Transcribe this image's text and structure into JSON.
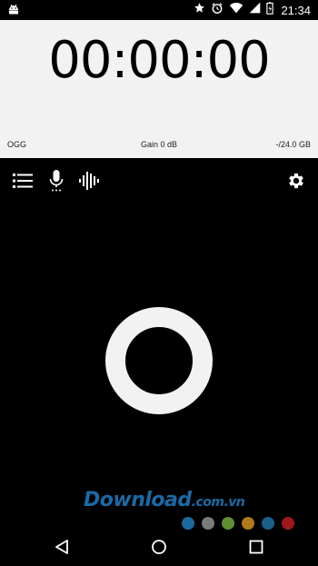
{
  "status_bar": {
    "time": "21:34",
    "icons": [
      "android-debug-icon",
      "star-icon",
      "alarm-icon",
      "wifi-icon",
      "signal-icon",
      "battery-charging-icon"
    ]
  },
  "timer": {
    "display": "00:00:00"
  },
  "meta": {
    "format": "OGG",
    "gain": "Gain 0 dB",
    "storage": "-/24.0 GB"
  },
  "toolbar": {
    "icons": [
      "list-icon",
      "microphone-icon",
      "waveform-icon",
      "gear-icon"
    ]
  },
  "record_button": {
    "icon": "record-circle-icon"
  },
  "watermark": {
    "brand": "Download",
    "suffix": ".com.vn",
    "dot_colors": [
      "#1a6aa0",
      "#7a7a7a",
      "#5f8f2f",
      "#b07a1a",
      "#1a5f8a",
      "#a0181c"
    ]
  },
  "nav": {
    "icons": [
      "back-icon",
      "home-icon",
      "recents-icon"
    ]
  },
  "colors": {
    "background": "#000000",
    "panel": "#f2f2f2",
    "watermark_blue": "#1b6aa5"
  }
}
